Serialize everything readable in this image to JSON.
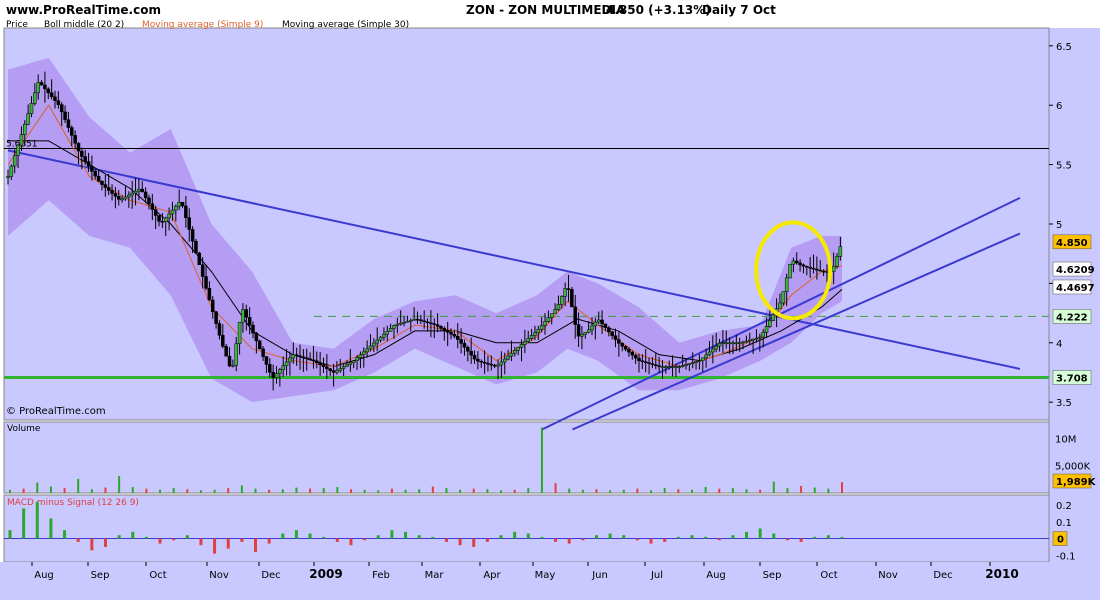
{
  "header": {
    "site": "www.ProRealTime.com",
    "title": "ZON - ZON MULTIMEDIA",
    "quote": "4.850 (+3.13%)",
    "period": "Daily  7 Oct"
  },
  "watermark": "© ProRealTime.com",
  "colors": {
    "panel_bg": "#c9c9ff",
    "band": "#ad8df0",
    "trend_line": "#3a3ad0",
    "support": "#32b432",
    "ma9": "#e0602a",
    "ma30": "#000000",
    "boll_mid": "#8a2a8a",
    "circle": "#f5ea00",
    "macd_pos": "#2ba82b",
    "macd_neg": "#e04040"
  },
  "chart_data": [
    {
      "type": "line",
      "name": "price-panel",
      "legend": [
        "Price",
        "Boll middle (20 2)",
        "Moving average (Simple 9)",
        "Moving average (Simple 30)"
      ],
      "ylim": [
        3.35,
        6.65
      ],
      "y_ticks": [
        3.5,
        4,
        4.5,
        5,
        5.5,
        6,
        6.5
      ],
      "x_labels": [
        "Aug",
        "Sep",
        "Oct",
        "Nov",
        "Dec",
        "2009",
        "Feb",
        "Mar",
        "Apr",
        "May",
        "Jun",
        "Jul",
        "Aug",
        "Sep",
        "Oct",
        "Nov",
        "Dec",
        "2010"
      ],
      "series": [
        {
          "name": "Price",
          "points": [
            [
              0,
              5.4
            ],
            [
              3,
              6.2
            ],
            [
              5,
              6.0
            ],
            [
              7,
              5.6
            ],
            [
              9,
              5.35
            ],
            [
              11,
              5.2
            ],
            [
              13,
              5.3
            ],
            [
              15,
              5.0
            ],
            [
              17,
              5.2
            ],
            [
              19,
              4.6
            ],
            [
              21,
              4.0
            ],
            [
              22,
              3.75
            ],
            [
              23,
              4.3
            ],
            [
              24,
              4.1
            ],
            [
              26,
              3.7
            ],
            [
              28,
              3.9
            ],
            [
              30,
              3.85
            ],
            [
              32,
              3.75
            ],
            [
              34,
              3.85
            ],
            [
              36,
              4.0
            ],
            [
              38,
              4.15
            ],
            [
              40,
              4.2
            ],
            [
              42,
              4.15
            ],
            [
              44,
              4.05
            ],
            [
              46,
              3.85
            ],
            [
              48,
              3.8
            ],
            [
              50,
              3.95
            ],
            [
              52,
              4.1
            ],
            [
              54,
              4.3
            ],
            [
              55,
              4.5
            ],
            [
              56,
              4.05
            ],
            [
              57,
              4.1
            ],
            [
              58,
              4.2
            ],
            [
              60,
              4.0
            ],
            [
              62,
              3.85
            ],
            [
              64,
              3.8
            ],
            [
              66,
              3.8
            ],
            [
              68,
              3.85
            ],
            [
              70,
              4.0
            ],
            [
              72,
              4.0
            ],
            [
              74,
              4.05
            ],
            [
              75,
              4.2
            ],
            [
              76,
              4.35
            ],
            [
              77,
              4.7
            ],
            [
              78,
              4.65
            ],
            [
              80,
              4.6
            ],
            [
              81,
              4.6
            ],
            [
              82,
              4.85
            ]
          ]
        },
        {
          "name": "Moving average (Simple 9)",
          "points": [
            [
              0,
              5.5
            ],
            [
              4,
              6.0
            ],
            [
              8,
              5.4
            ],
            [
              12,
              5.2
            ],
            [
              16,
              5.1
            ],
            [
              20,
              4.3
            ],
            [
              24,
              3.95
            ],
            [
              28,
              3.85
            ],
            [
              32,
              3.8
            ],
            [
              36,
              3.95
            ],
            [
              40,
              4.15
            ],
            [
              44,
              4.1
            ],
            [
              48,
              3.85
            ],
            [
              52,
              4.05
            ],
            [
              55,
              4.35
            ],
            [
              58,
              4.15
            ],
            [
              62,
              3.9
            ],
            [
              66,
              3.8
            ],
            [
              70,
              3.9
            ],
            [
              74,
              4.05
            ],
            [
              77,
              4.4
            ],
            [
              80,
              4.6
            ],
            [
              82,
              4.65
            ]
          ]
        },
        {
          "name": "Moving average (Simple 30)",
          "points": [
            [
              0,
              5.7
            ],
            [
              4,
              5.7
            ],
            [
              8,
              5.5
            ],
            [
              12,
              5.3
            ],
            [
              16,
              5.0
            ],
            [
              20,
              4.6
            ],
            [
              24,
              4.1
            ],
            [
              28,
              3.9
            ],
            [
              32,
              3.8
            ],
            [
              36,
              3.9
            ],
            [
              40,
              4.1
            ],
            [
              44,
              4.1
            ],
            [
              48,
              4.0
            ],
            [
              52,
              4.0
            ],
            [
              56,
              4.2
            ],
            [
              60,
              4.1
            ],
            [
              64,
              3.9
            ],
            [
              68,
              3.85
            ],
            [
              72,
              3.95
            ],
            [
              76,
              4.1
            ],
            [
              80,
              4.3
            ],
            [
              82,
              4.45
            ]
          ]
        }
      ],
      "boll_upper": [
        [
          0,
          6.3
        ],
        [
          4,
          6.4
        ],
        [
          8,
          5.9
        ],
        [
          12,
          5.6
        ],
        [
          16,
          5.8
        ],
        [
          20,
          5.0
        ],
        [
          24,
          4.6
        ],
        [
          28,
          4.0
        ],
        [
          32,
          3.95
        ],
        [
          36,
          4.2
        ],
        [
          40,
          4.35
        ],
        [
          44,
          4.4
        ],
        [
          48,
          4.25
        ],
        [
          52,
          4.4
        ],
        [
          55,
          4.6
        ],
        [
          58,
          4.5
        ],
        [
          62,
          4.3
        ],
        [
          66,
          4.0
        ],
        [
          70,
          4.1
        ],
        [
          74,
          4.15
        ],
        [
          77,
          4.8
        ],
        [
          80,
          4.9
        ],
        [
          82,
          4.9
        ]
      ],
      "boll_lower": [
        [
          0,
          4.9
        ],
        [
          4,
          5.2
        ],
        [
          8,
          4.9
        ],
        [
          12,
          4.8
        ],
        [
          16,
          4.4
        ],
        [
          20,
          3.7
        ],
        [
          24,
          3.5
        ],
        [
          28,
          3.55
        ],
        [
          32,
          3.6
        ],
        [
          36,
          3.75
        ],
        [
          40,
          3.95
        ],
        [
          44,
          3.8
        ],
        [
          48,
          3.65
        ],
        [
          52,
          3.75
        ],
        [
          55,
          3.95
        ],
        [
          58,
          3.85
        ],
        [
          62,
          3.6
        ],
        [
          66,
          3.6
        ],
        [
          70,
          3.7
        ],
        [
          74,
          3.85
        ],
        [
          77,
          4.0
        ],
        [
          80,
          4.25
        ],
        [
          82,
          4.35
        ]
      ],
      "annotations": {
        "hline_top": "5.6351",
        "price_tags": [
          {
            "value": 4.85,
            "label": "4.850",
            "bg": "#ffc000",
            "fg": "#000"
          },
          {
            "value": 4.6209,
            "label": "4.6209",
            "bg": "#ffffff",
            "fg": "#8a2a8a"
          },
          {
            "value": 4.4697,
            "label": "4.4697",
            "bg": "#ffffff",
            "fg": "#000"
          },
          {
            "value": 4.222,
            "label": "4.222",
            "bg": "#d7ffd7",
            "fg": "#000"
          },
          {
            "value": 3.708,
            "label": "3.708",
            "bg": "#d7ffd7",
            "fg": "#000"
          }
        ],
        "support_level": 3.708,
        "dashed_level": 4.222
      }
    },
    {
      "type": "bar",
      "name": "volume-panel",
      "legend": [
        "Volume"
      ],
      "y_ticks": [
        "10M",
        "5,000K"
      ],
      "last_label": "1,989K",
      "ylim": [
        0,
        13
      ],
      "values": [
        0.6,
        0.8,
        1.9,
        1.2,
        0.9,
        2.6,
        0.7,
        1.0,
        3.1,
        1.1,
        0.8,
        0.6,
        0.9,
        0.7,
        0.5,
        0.6,
        0.9,
        1.4,
        0.8,
        0.6,
        0.7,
        1.0,
        0.8,
        0.9,
        1.1,
        0.7,
        0.6,
        0.5,
        0.8,
        0.6,
        0.7,
        1.2,
        0.9,
        0.6,
        0.8,
        0.7,
        0.5,
        0.6,
        0.9,
        12.0,
        1.8,
        0.8,
        0.6,
        0.7,
        0.5,
        0.6,
        0.8,
        0.5,
        0.9,
        0.7,
        0.6,
        1.1,
        0.8,
        0.9,
        0.7,
        0.6,
        2.1,
        0.9,
        1.3,
        1.0,
        0.8,
        2.0
      ]
    },
    {
      "type": "bar",
      "name": "macd-panel",
      "legend": [
        "MACD minus Signal (12 26 9)"
      ],
      "y_ticks": [
        0.2,
        0.1,
        -0.1
      ],
      "last_label": "0",
      "ylim": [
        -0.14,
        0.26
      ],
      "values": [
        0.05,
        0.18,
        0.22,
        0.12,
        0.05,
        -0.02,
        -0.07,
        -0.05,
        0.02,
        0.04,
        0.01,
        -0.03,
        -0.01,
        0.02,
        -0.04,
        -0.09,
        -0.06,
        -0.02,
        -0.08,
        -0.03,
        0.03,
        0.05,
        0.03,
        0.01,
        -0.02,
        -0.04,
        -0.01,
        0.02,
        0.05,
        0.04,
        0.02,
        0.01,
        -0.02,
        -0.04,
        -0.05,
        -0.02,
        0.02,
        0.04,
        0.03,
        0.01,
        -0.02,
        -0.03,
        -0.01,
        0.02,
        0.03,
        0.02,
        -0.01,
        -0.03,
        -0.02,
        0.01,
        0.02,
        0.01,
        -0.01,
        0.02,
        0.04,
        0.06,
        0.03,
        -0.01,
        -0.02,
        0.01,
        0.02,
        0.01
      ]
    }
  ]
}
